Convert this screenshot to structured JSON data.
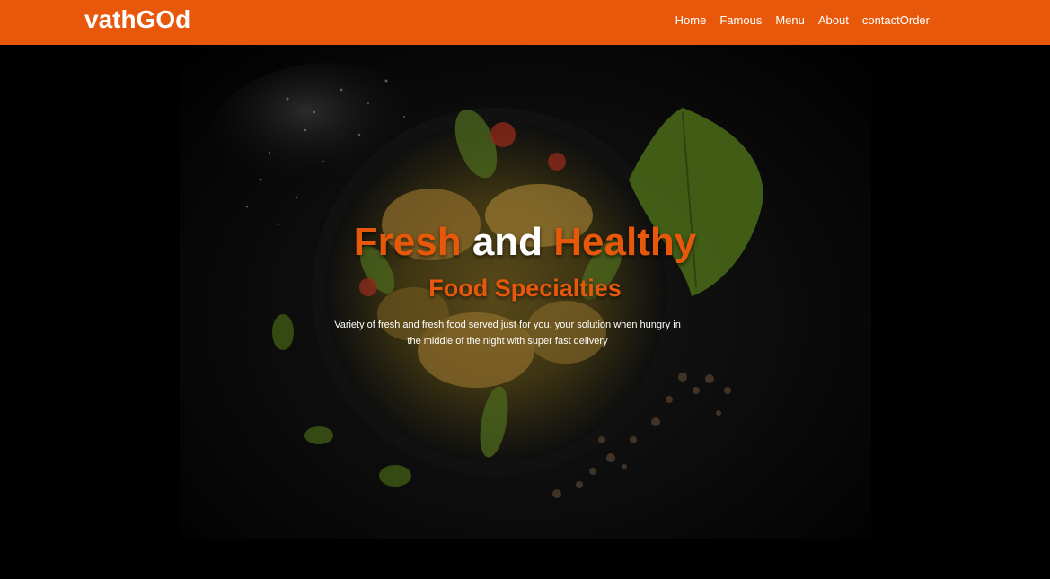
{
  "brand": {
    "name": "vathGOd"
  },
  "nav": {
    "items": [
      {
        "label": "Home"
      },
      {
        "label": "Famous"
      },
      {
        "label": "Menu"
      },
      {
        "label": "About"
      },
      {
        "label": "contact"
      },
      {
        "label": "Order"
      }
    ]
  },
  "hero": {
    "headline": {
      "word1": "Fresh",
      "word2": "and",
      "word3": "Healthy"
    },
    "subheadline": "Food Specialties",
    "description": "Variety of fresh and fresh food served just for you, your solution when hungry in the middle of the night with super fast delivery"
  },
  "colors": {
    "accent": "#e8580a",
    "navbar": "#e8580a",
    "background": "#000000",
    "text": "#ffffff"
  }
}
